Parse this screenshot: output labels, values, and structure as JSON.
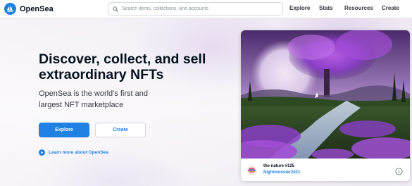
{
  "nav": {
    "brand": "OpenSea",
    "search_placeholder": "Search items, collections, and accounts",
    "links": [
      "Explore",
      "Stats",
      "Resources",
      "Create"
    ]
  },
  "hero": {
    "headline_line1": "Discover, collect, and sell",
    "headline_line2": "extraordinary NFTs",
    "subline_line1": "OpenSea is the world's first and",
    "subline_line2": "largest NFT marketplace",
    "explore_label": "Explore",
    "create_label": "Create",
    "learn_more": "Learn more about OpenSea"
  },
  "featured": {
    "title": "the nature #125",
    "creator": "Nightmonster2021"
  },
  "colors": {
    "accent": "#2081e2",
    "text_dark": "#04111d",
    "text_body": "#353840",
    "art_purple": "#8a3fc7"
  },
  "icons": [
    "opensea-logo-icon",
    "search-icon",
    "play-circle-icon",
    "info-icon"
  ]
}
